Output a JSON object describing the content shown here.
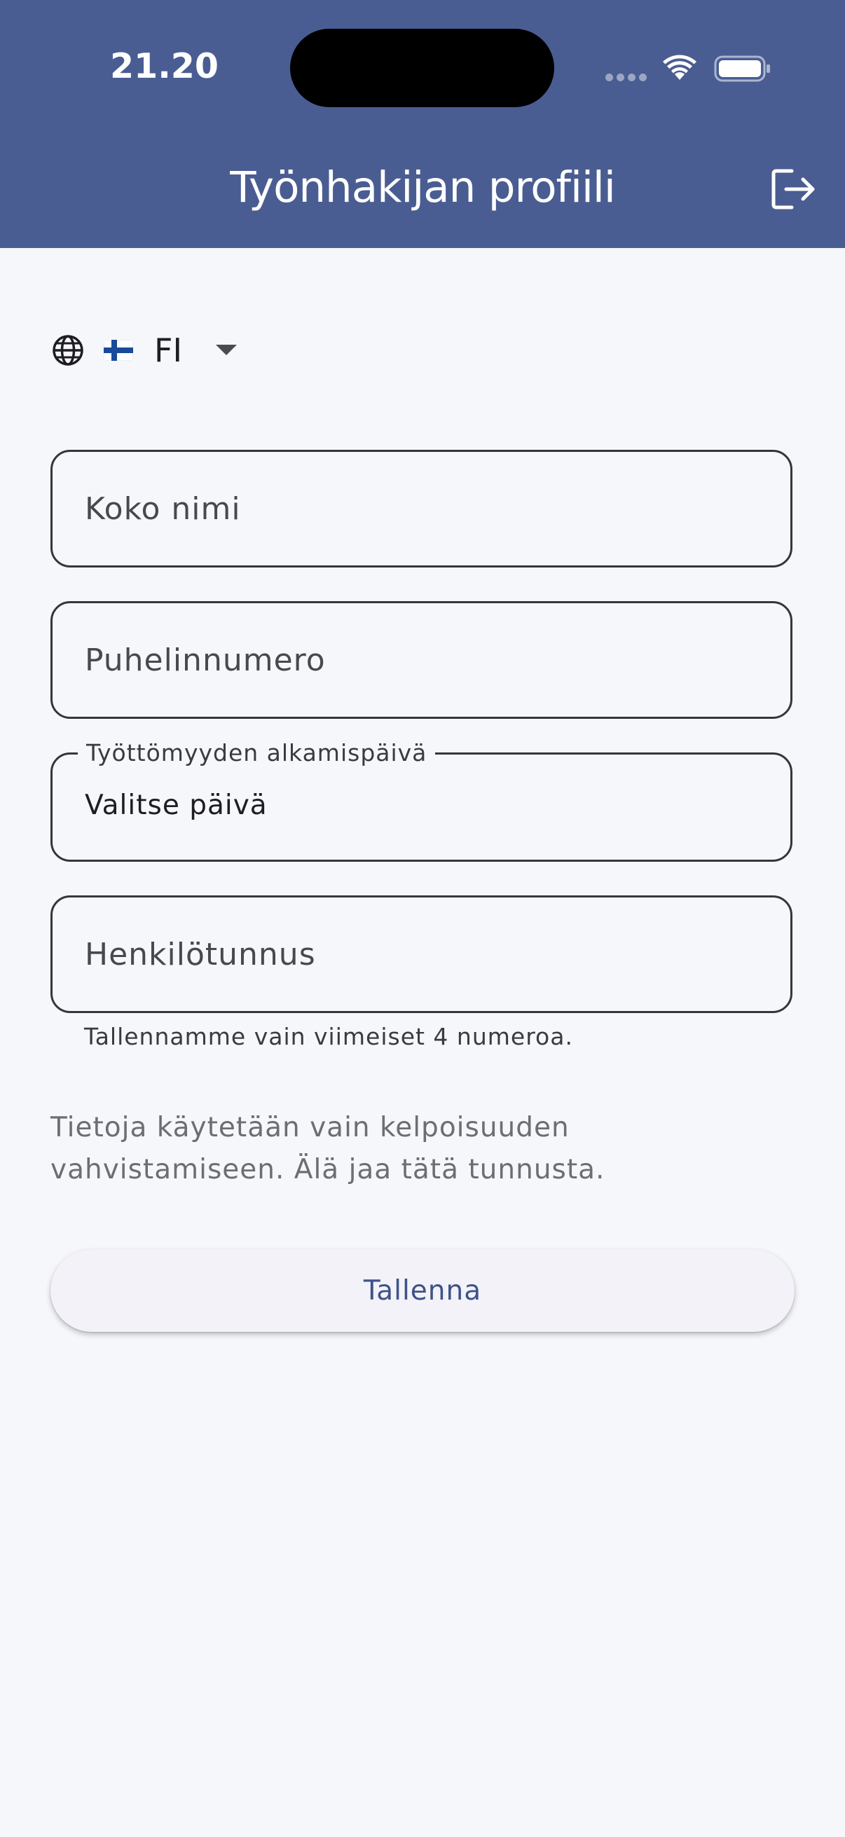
{
  "status_bar": {
    "time": "21.20"
  },
  "header": {
    "title": "Työnhakijan profiili",
    "logout_icon": "logout-icon"
  },
  "language": {
    "globe_icon": "globe-icon",
    "flag_icon": "finland-flag-icon",
    "selected": "FI"
  },
  "form": {
    "full_name": {
      "placeholder": "Koko nimi",
      "value": ""
    },
    "phone": {
      "placeholder": "Puhelinnumero",
      "value": ""
    },
    "unemployment_start": {
      "label": "Työttömyyden alkamispäivä",
      "value": "Valitse päivä"
    },
    "ssn": {
      "placeholder": "Henkilötunnus",
      "value": "",
      "helper": "Tallennamme vain viimeiset 4 numeroa."
    },
    "info_line1": "Tietoja käytetään vain kelpoisuuden",
    "info_line2": "vahvistamiseen. Älä jaa tätä tunnusta.",
    "save_label": "Tallenna"
  },
  "colors": {
    "app_bar": "#4a5d92",
    "background": "#f6f7fa",
    "button_text": "#3f5389",
    "button_background": "#f2f2f8"
  }
}
